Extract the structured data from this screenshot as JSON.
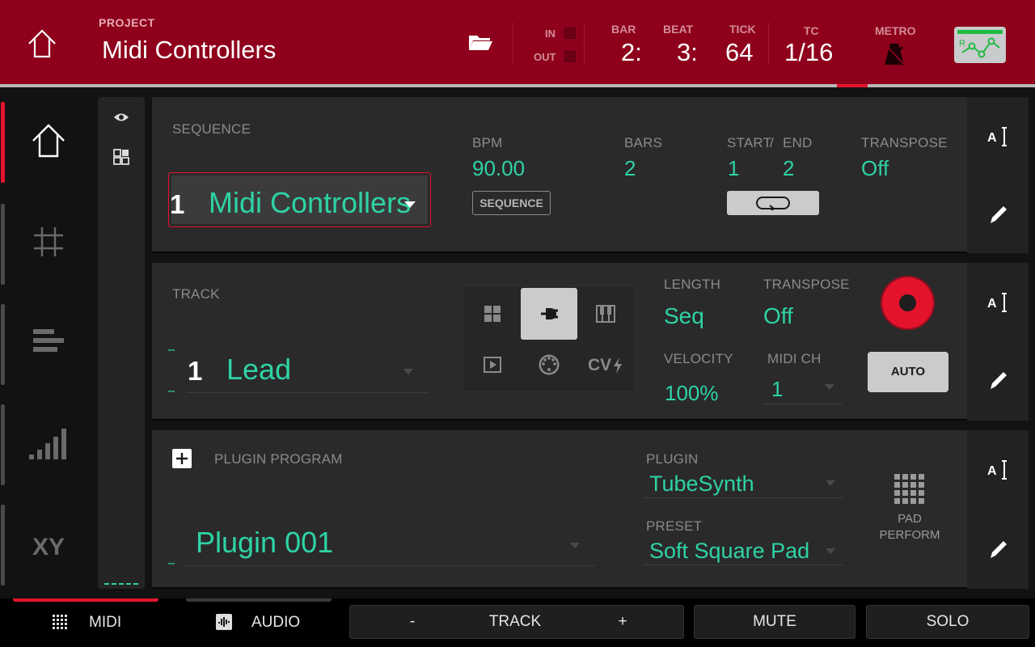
{
  "header": {
    "project_label": "PROJECT",
    "project_name": "Midi Controllers",
    "in_label": "IN",
    "out_label": "OUT",
    "bar_label": "BAR",
    "bar_value": "2:",
    "beat_label": "BEAT",
    "beat_value": "3:",
    "tick_label": "TICK",
    "tick_value": "64",
    "tc_label": "TC",
    "tc_value": "1/16",
    "metro_label": "METRO"
  },
  "nav": {
    "items": [
      "home-icon",
      "grid-icon",
      "list-edit-icon",
      "mixer-icon",
      "xy-fx-icon"
    ]
  },
  "sequence": {
    "label": "SEQUENCE",
    "number": "1",
    "name": "Midi Controllers",
    "bpm_label": "BPM",
    "bpm_value": "90.00",
    "bpm_mode_button": "SEQUENCE",
    "bars_label": "BARS",
    "bars_value": "2",
    "start_label": "START",
    "slash": "/",
    "end_label": "END",
    "start_value": "1",
    "end_value": "2",
    "transpose_label": "TRANSPOSE",
    "transpose_value": "Off"
  },
  "track": {
    "label": "TRACK",
    "number": "1",
    "name": "Lead",
    "dash_top": "--",
    "dash_bottom": "--",
    "type_cv_label": "CV",
    "length_label": "LENGTH",
    "length_value": "Seq",
    "transpose_label": "TRANSPOSE",
    "transpose_value": "Off",
    "velocity_label": "VELOCITY",
    "velocity_value": "100%",
    "midich_label": "MIDI CH",
    "midich_value": "1",
    "auto_button": "AUTO"
  },
  "plugin": {
    "program_label": "PLUGIN PROGRAM",
    "program_dash": "--",
    "program_name": "Plugin 001",
    "plugin_label": "PLUGIN",
    "plugin_value": "TubeSynth",
    "preset_label": "PRESET",
    "preset_value": "Soft Square Pad",
    "pad_perform_line1": "PAD",
    "pad_perform_line2": "PERFORM"
  },
  "footer": {
    "midi_label": "MIDI",
    "audio_label": "AUDIO",
    "track_minus": "-",
    "track_label": "TRACK",
    "track_plus": "+",
    "mute_label": "MUTE",
    "solo_label": "SOLO"
  },
  "colors": {
    "header_bg": "#8e001b",
    "accent_red": "#e4132c",
    "value_teal": "#2ed3a4",
    "panel_bg": "#2a2a2b"
  }
}
